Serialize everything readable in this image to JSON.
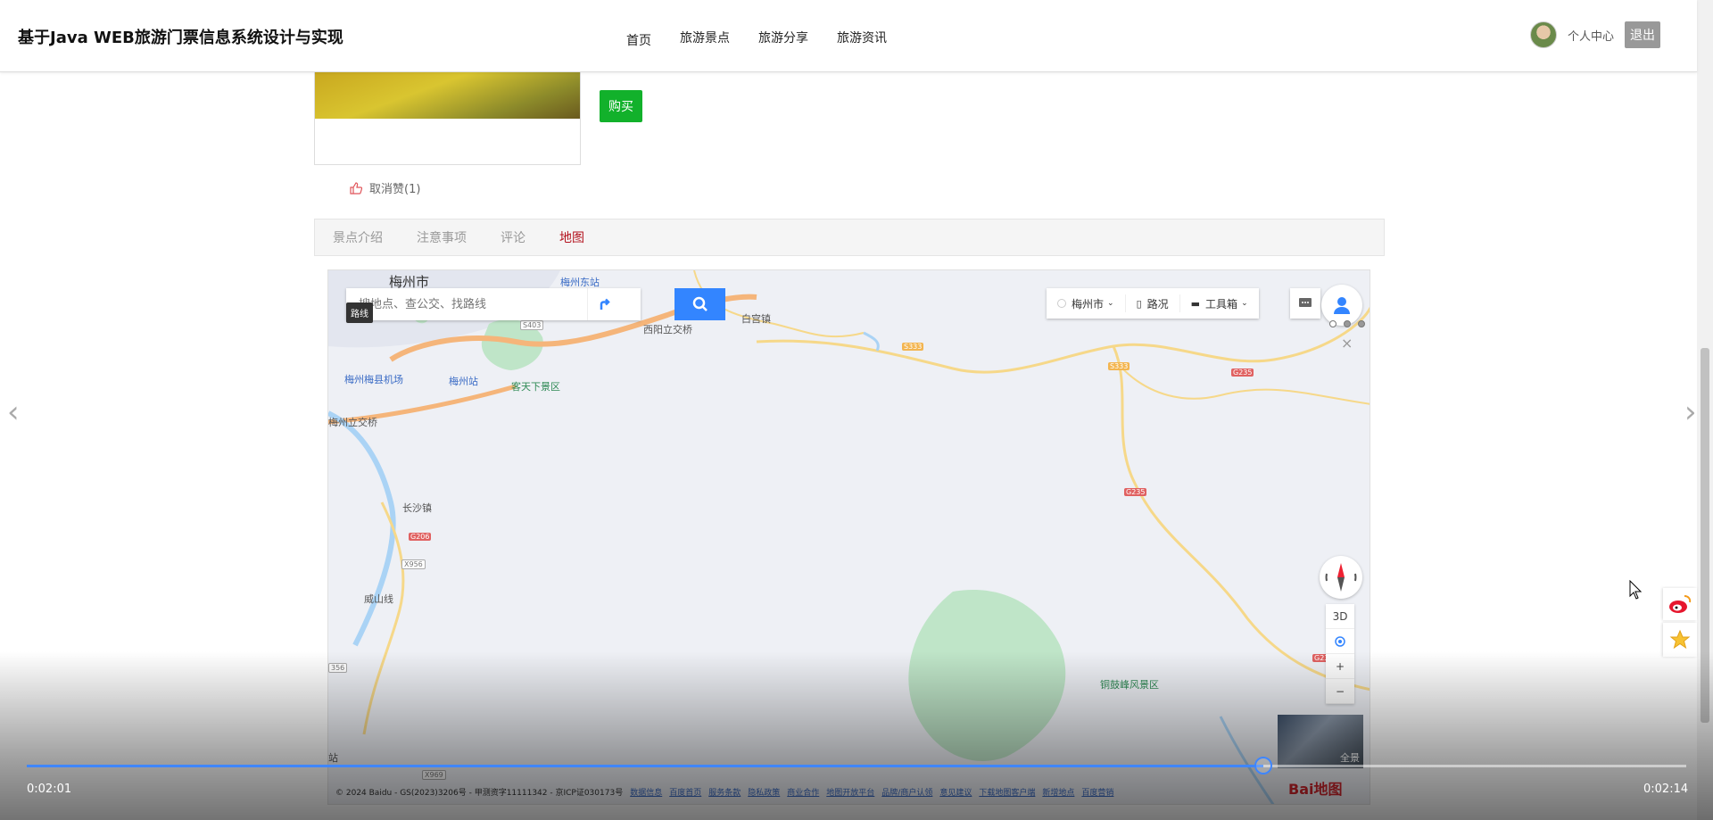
{
  "header": {
    "site_title": "基于Java WEB旅游门票信息系统设计与实现",
    "nav": [
      "首页",
      "旅游景点",
      "旅游分享",
      "旅游资讯"
    ],
    "user_center": "个人中心",
    "logout": "退出"
  },
  "product": {
    "buy_label": "购买",
    "like_label": "取消赞(1)"
  },
  "tabs": [
    {
      "label": "景点介绍",
      "active": false
    },
    {
      "label": "注意事项",
      "active": false
    },
    {
      "label": "评论",
      "active": false
    },
    {
      "label": "地图",
      "active": true
    }
  ],
  "map": {
    "search_placeholder": "搜地点、查公交、找路线",
    "tooltip": "路线",
    "toolbar": {
      "city": "梅州市",
      "traffic": "路况",
      "tools": "工具箱"
    },
    "controls": {
      "three_d": "3D",
      "zoom_in": "+",
      "zoom_out": "−",
      "close": "×",
      "panorama": "全景"
    },
    "labels": {
      "city": "梅州市",
      "east_station": "梅州东站",
      "xiyang": "西阳立交桥",
      "baigong": "白宫镇",
      "airport": "梅州梅县机场",
      "station": "梅州站",
      "kejia": "客天下景区",
      "meizhou_interchange": "梅州立交桥",
      "changsha": "长沙镇",
      "weishan": "威山线",
      "tonggu": "铜鼓峰风景区",
      "zhan": "站"
    },
    "road_badges": {
      "s333a": "S333",
      "s333b": "S333",
      "g235a": "G235",
      "g235b": "G235",
      "g235c": "G235",
      "g206": "G206",
      "x956a": "X956",
      "x956b": "356",
      "x969": "X969",
      "s403": "S403"
    },
    "footer": {
      "copyright": "© 2024 Baidu - GS(2023)3206号 - 甲测资字11111342 - 京ICP证030173号",
      "links": [
        "数据信息",
        "百度首页",
        "服务条款",
        "隐私政策",
        "商业合作",
        "地图开放平台",
        "品牌/商户认领",
        "意见建议",
        "下载地图客户端",
        "新增地点",
        "百度营销"
      ]
    },
    "logo": "Bai地图"
  },
  "video": {
    "current_time": "0:02:01",
    "total_time": "0:02:14",
    "progress": 0.745
  }
}
